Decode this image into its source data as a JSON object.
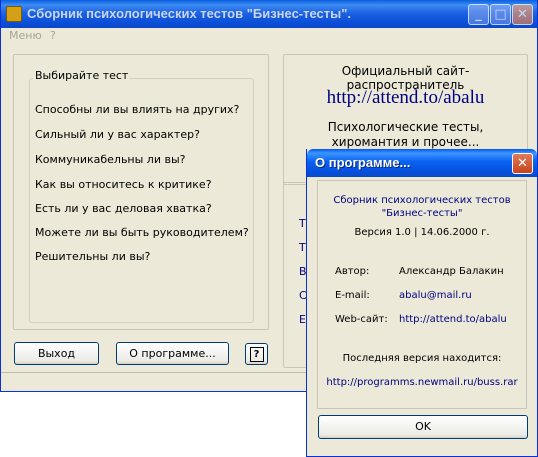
{
  "window": {
    "title": "Сборник психологических тестов \"Бизнес-тесты\".",
    "minimize_glyph": "_",
    "maximize_glyph": "□",
    "close_glyph": "✕"
  },
  "menu": {
    "items": [
      "Меню",
      "?"
    ]
  },
  "tests": {
    "legend": "Выбирайте тест",
    "items": [
      "Способны ли вы влиять на других?",
      "Сильный ли у вас характер?",
      "Коммуникабельны ли вы?",
      "Как вы относитесь к критике?",
      "Есть ли у вас деловая хватка?",
      "Можете ли вы быть руководителем?",
      "Решительны ли вы?"
    ]
  },
  "buttons": {
    "exit": "Выход",
    "about": "О программе...",
    "help": "?"
  },
  "site": {
    "official": "Официальный сайт-распространитель",
    "url": "http://attend.to/abalu",
    "desc_line1": "Психологические тесты,",
    "desc_line2": "хиромантия и прочее..."
  },
  "partial_text": [
    "Т",
    "Т",
    "В",
    "С",
    "Е"
  ],
  "dialog": {
    "title": "О программе...",
    "close_glyph": "✕",
    "app_line1": "Сборник психологических тестов",
    "app_line2": "\"Бизнес-тесты\"",
    "version": "Версия 1.0 | 14.06.2000 г.",
    "author_label": "Автор:",
    "author_value": "Александр Балакин",
    "email_label": "E-mail:",
    "email_value": "abalu@mail.ru",
    "site_label": "Web-сайт:",
    "site_value": "http://attend.to/abalu",
    "latest_label": "Последняя версия находится:",
    "latest_url": "http://programms.newmail.ru/buss.rar",
    "ok": "OK"
  },
  "colors": {
    "titlebar": "#0a5fe0",
    "face": "#ece9d8",
    "link_blue": "#000080"
  }
}
